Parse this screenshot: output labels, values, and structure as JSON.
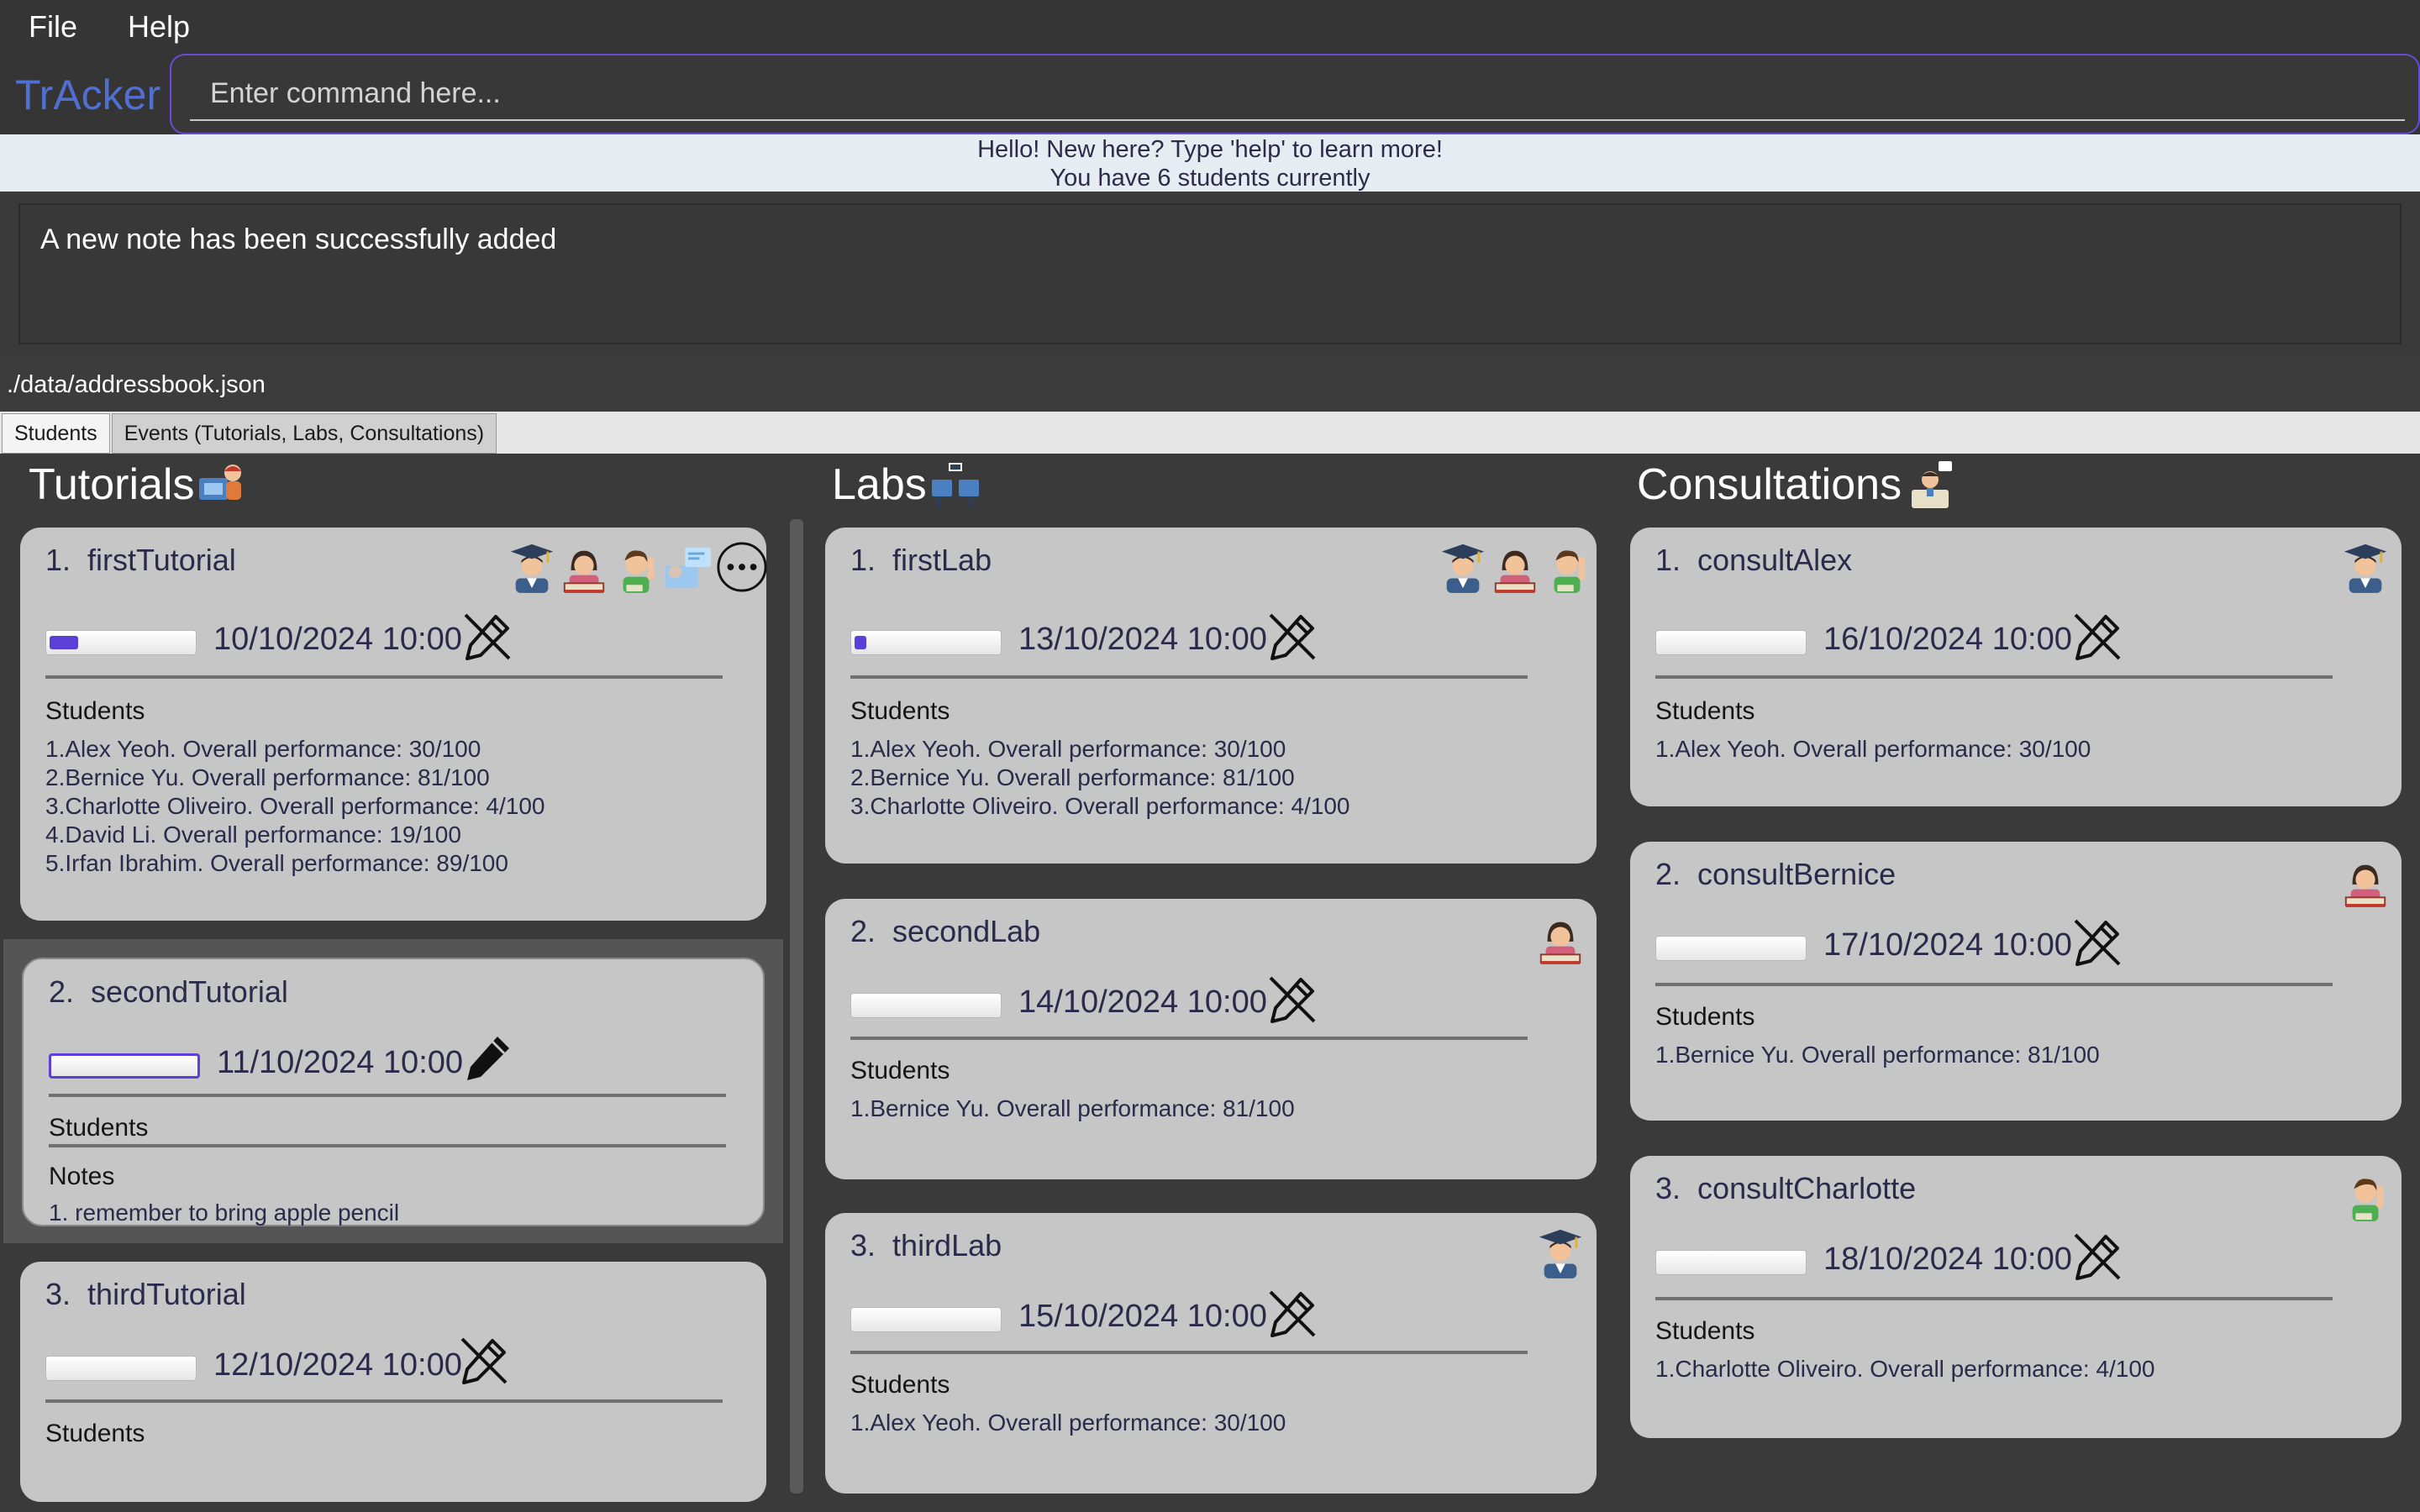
{
  "menu": {
    "file": "File",
    "help": "Help"
  },
  "app": {
    "logo": "TrAcker"
  },
  "command": {
    "placeholder": "Enter command here..."
  },
  "welcome": {
    "line1": "Hello! New here? Type 'help' to learn more!",
    "line2": "You have 6 students currently"
  },
  "result": {
    "text": "A new note has been successfully added"
  },
  "status": {
    "path": "./data/addressbook.json"
  },
  "tabs": {
    "students": "Students",
    "events": "Events (Tutorials, Labs, Consultations)"
  },
  "columns": {
    "tutorials": "Tutorials",
    "labs": "Labs",
    "consultations": "Consultations"
  },
  "tutorials": [
    {
      "index": "1.",
      "name": "firstTutorial",
      "date": "10/10/2024 10:00",
      "progress": 0.2,
      "students_label": "Students",
      "students": [
        "1.Alex Yeoh. Overall performance: 30/100",
        "2.Bernice Yu. Overall performance: 81/100",
        "3.Charlotte Oliveiro. Overall performance: 4/100",
        "4.David Li. Overall performance: 19/100",
        "5.Irfan Ibrahim. Overall performance: 89/100"
      ],
      "avatars": [
        "graduate-icon",
        "student-reading-icon",
        "student-waving-icon",
        "online-class-icon",
        "more-icon"
      ]
    },
    {
      "index": "2.",
      "name": "secondTutorial",
      "date": "11/10/2024 10:00",
      "progress": 0.0,
      "students_label": "Students",
      "notes_label": "Notes",
      "notes": [
        "1. remember to bring apple pencil"
      ]
    },
    {
      "index": "3.",
      "name": "thirdTutorial",
      "date": "12/10/2024 10:00",
      "progress": 0.0,
      "students_label": "Students"
    }
  ],
  "labs": [
    {
      "index": "1.",
      "name": "firstLab",
      "date": "13/10/2024 10:00",
      "progress": 0.08,
      "students_label": "Students",
      "students": [
        "1.Alex Yeoh. Overall performance: 30/100",
        "2.Bernice Yu. Overall performance: 81/100",
        "3.Charlotte Oliveiro. Overall performance: 4/100"
      ]
    },
    {
      "index": "2.",
      "name": "secondLab",
      "date": "14/10/2024 10:00",
      "progress": 0.0,
      "students_label": "Students",
      "students": [
        "1.Bernice Yu. Overall performance: 81/100"
      ]
    },
    {
      "index": "3.",
      "name": "thirdLab",
      "date": "15/10/2024 10:00",
      "progress": 0.0,
      "students_label": "Students",
      "students": [
        "1.Alex Yeoh. Overall performance: 30/100"
      ]
    }
  ],
  "consultations": [
    {
      "index": "1.",
      "name": "consultAlex",
      "date": "16/10/2024 10:00",
      "progress": 0.0,
      "students_label": "Students",
      "students": [
        "1.Alex Yeoh. Overall performance: 30/100"
      ]
    },
    {
      "index": "2.",
      "name": "consultBernice",
      "date": "17/10/2024 10:00",
      "progress": 0.0,
      "students_label": "Students",
      "students": [
        "1.Bernice Yu. Overall performance: 81/100"
      ]
    },
    {
      "index": "3.",
      "name": "consultCharlotte",
      "date": "18/10/2024 10:00",
      "progress": 0.0,
      "students_label": "Students",
      "students": [
        "1.Charlotte Oliveiro. Overall performance: 4/100"
      ]
    }
  ],
  "colors": {
    "accent": "#5b3fd6",
    "logo": "#4f6fd2",
    "card": "#c6c6c6",
    "background": "#3a3a3a"
  }
}
